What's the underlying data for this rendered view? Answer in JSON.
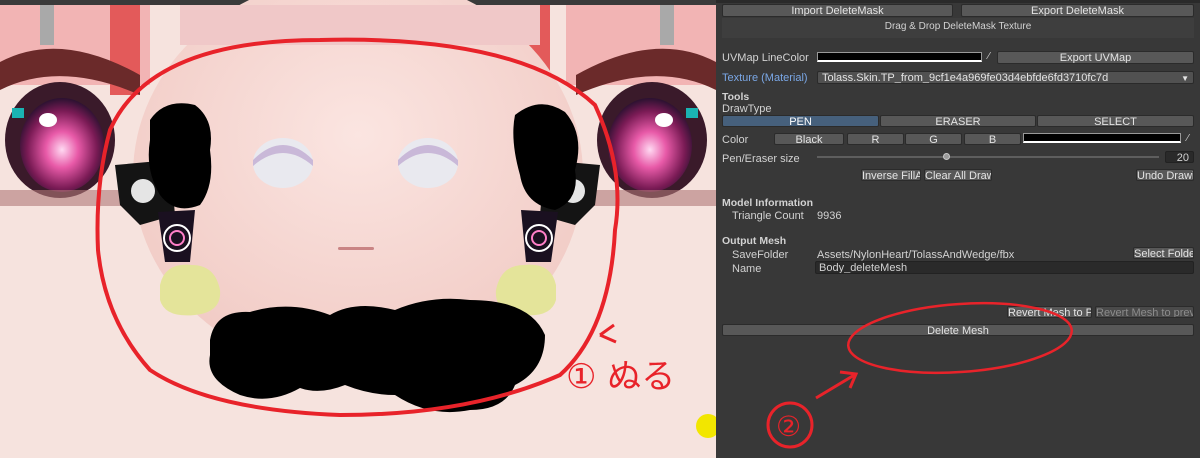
{
  "texture_panel": {
    "annotation_label": "① ぬる"
  },
  "inspector": {
    "import_button": "Import DeleteMask",
    "export_button": "Export DeleteMask",
    "drop_area": "Drag & Drop DeleteMask Texture",
    "uvmap_label": "UVMap LineColor",
    "uvmap_color": "#ffffff",
    "export_uvmap_button": "Export UVMap",
    "texture_label": "Texture (Material)",
    "texture_value": "Tolass.Skin.TP_from_9cf1e4a969fe03d4ebfde6fd3710fc7d",
    "tools_header": "Tools",
    "drawtype_label": "DrawType",
    "drawtype_tabs": [
      "PEN",
      "ERASER",
      "SELECT"
    ],
    "drawtype_selected": "PEN",
    "color_label": "Color",
    "color_buttons": [
      "Black",
      "R",
      "G",
      "B"
    ],
    "pen_color": "#ffffff",
    "pen_size_label": "Pen/Eraser size",
    "pen_size_value": "20",
    "pen_size_fraction": 0.38,
    "inverse_button": "Inverse FillArea",
    "clear_button": "Clear All Drawing",
    "undo_button": "Undo Drawing",
    "model_header": "Model Information",
    "triangle_label": "Triangle Count",
    "triangle_value": "9936",
    "output_header": "Output Mesh",
    "savefolder_label": "SaveFolder",
    "savefolder_value": "Assets/NylonHeart/TolassAndWedge/fbx",
    "select_folder_button": "Select Folder",
    "name_label": "Name",
    "name_value": "Body_deleteMesh",
    "revert_prefab_button": "Revert Mesh to Prefab",
    "revert_prev_button": "Revert Mesh to previously",
    "delete_mesh_button": "Delete Mesh",
    "annotation_label": "②"
  },
  "colors": {
    "annotation_red": "#e8232a",
    "selection_blue": "#46607c",
    "panel_bg": "#383838"
  }
}
